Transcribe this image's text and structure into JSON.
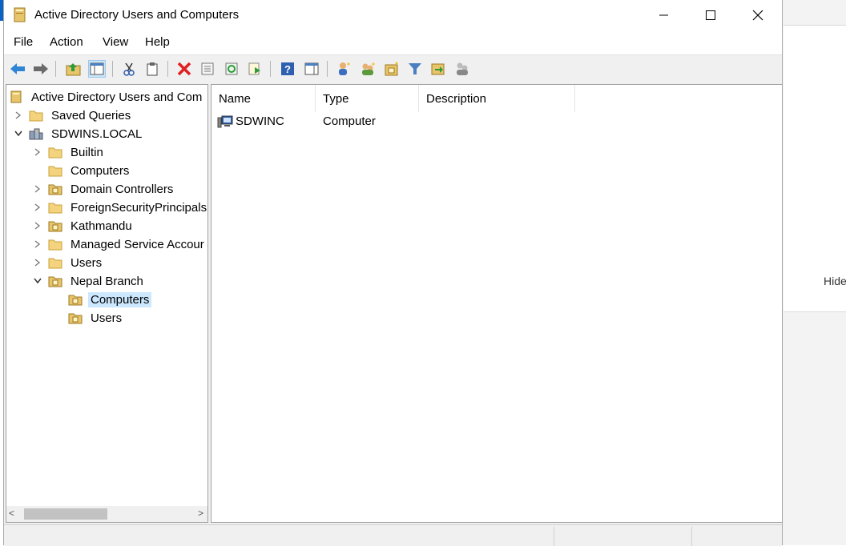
{
  "window": {
    "title": "Active Directory Users and Computers"
  },
  "menu": {
    "items": [
      "File",
      "Action",
      "View",
      "Help"
    ]
  },
  "toolbar": {
    "icons": [
      "back-icon",
      "forward-icon",
      "up-folder-icon",
      "console-tree-icon",
      "cut-icon",
      "copy-icon",
      "delete-icon",
      "properties-icon",
      "refresh-icon",
      "export-list-icon",
      "help-icon",
      "show-hide-icon",
      "new-user-icon",
      "new-group-icon",
      "new-ou-icon",
      "filter-icon",
      "move-icon",
      "delegate-icon"
    ]
  },
  "tree": {
    "root": "Active Directory Users and Com",
    "items": [
      {
        "label": "Saved Queries"
      },
      {
        "label": "SDWINS.LOCAL"
      },
      {
        "label": "Builtin"
      },
      {
        "label": "Computers"
      },
      {
        "label": "Domain Controllers"
      },
      {
        "label": "ForeignSecurityPrincipals"
      },
      {
        "label": "Kathmandu"
      },
      {
        "label": "Managed Service Accour"
      },
      {
        "label": "Users"
      },
      {
        "label": "Nepal Branch"
      },
      {
        "label": "Computers"
      },
      {
        "label": "Users"
      }
    ]
  },
  "list": {
    "columns": [
      "Name",
      "Type",
      "Description"
    ],
    "rows": [
      {
        "name": "SDWINC",
        "type": "Computer",
        "description": ""
      }
    ]
  },
  "background": {
    "right_text": "Hide"
  },
  "colors": {
    "selection": "#cce8ff",
    "folder": "#e8c46a",
    "delete_red": "#e02020",
    "nav_blue": "#2f84d4"
  }
}
